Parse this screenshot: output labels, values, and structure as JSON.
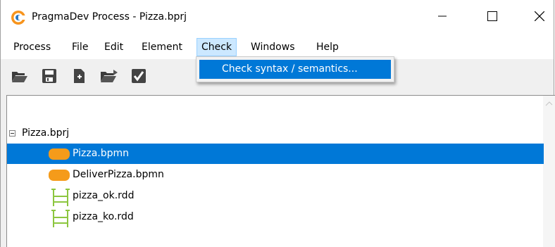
{
  "window": {
    "title": "PragmaDev Process - Pizza.bprj",
    "app_icon": "pragmadev-logo-icon",
    "controls": [
      "minimize-icon",
      "maximize-icon",
      "close-icon"
    ]
  },
  "menubar": {
    "items": [
      {
        "label": "Process"
      },
      {
        "label": "File"
      },
      {
        "label": "Edit"
      },
      {
        "label": "Element"
      },
      {
        "label": "Check",
        "active": true
      },
      {
        "label": "Windows"
      },
      {
        "label": "Help"
      }
    ]
  },
  "toolbar": {
    "buttons": [
      "open-folder-icon",
      "save-icon",
      "new-file-icon",
      "open-project-icon",
      "check-icon"
    ]
  },
  "dropdown": {
    "items": [
      {
        "label": "Check syntax / semantics...",
        "highlighted": true
      }
    ]
  },
  "tree": {
    "root": {
      "label": "Pizza.bprj",
      "expanded": true
    },
    "children": [
      {
        "label": "Pizza.bpmn",
        "icon": "bpmn-icon",
        "selected": true
      },
      {
        "label": "DeliverPizza.bpmn",
        "icon": "bpmn-icon",
        "selected": false
      },
      {
        "label": "pizza_ok.rdd",
        "icon": "rdd-icon",
        "selected": false
      },
      {
        "label": "pizza_ko.rdd",
        "icon": "rdd-icon",
        "selected": false
      }
    ]
  },
  "colors": {
    "selection": "#0078d7",
    "menu_active": "#cce8ff",
    "bpmn_icon": "#f59b1a",
    "rdd_icon": "#8cc63f"
  }
}
